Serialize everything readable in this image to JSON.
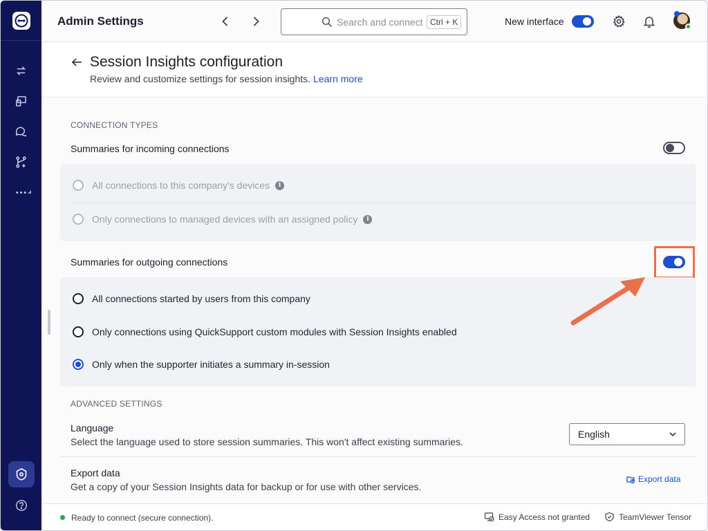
{
  "topbar": {
    "title": "Admin Settings",
    "search_placeholder": "Search and connect",
    "search_shortcut": "Ctrl + K",
    "new_interface_label": "New interface",
    "new_interface_on": true
  },
  "header": {
    "title": "Session Insights configuration",
    "subtitle": "Review and customize settings for session insights.",
    "learn_more": "Learn more"
  },
  "connection_types": {
    "section_label": "CONNECTION TYPES",
    "incoming": {
      "label": "Summaries for incoming connections",
      "enabled": false,
      "options": [
        "All connections to this company's devices",
        "Only connections to managed devices with an assigned policy"
      ]
    },
    "outgoing": {
      "label": "Summaries for outgoing connections",
      "enabled": true,
      "options": [
        "All connections started by users from this company",
        "Only connections using QuickSupport custom modules with Session Insights enabled",
        "Only when the supporter initiates a summary in-session"
      ],
      "selected_index": 2
    }
  },
  "advanced": {
    "section_label": "ADVANCED SETTINGS",
    "language": {
      "label": "Language",
      "description": "Select the language used to store session summaries. This won't affect existing summaries.",
      "value": "English"
    },
    "export": {
      "label": "Export data",
      "description": "Get a copy of your Session Insights data for backup or for use with other services.",
      "link": "Export data"
    }
  },
  "status_bar": {
    "ready": "Ready to connect (secure connection).",
    "easy_access": "Easy Access not granted",
    "tensor": "TeamViewer Tensor"
  },
  "colors": {
    "rail": "#0e1456",
    "accent": "#1f4fd1",
    "annotation": "#e8704a",
    "online": "#26a84a"
  }
}
